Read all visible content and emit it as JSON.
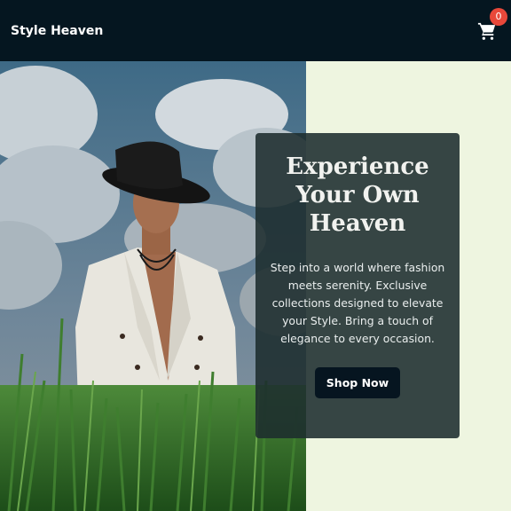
{
  "nav": {
    "brand": "Style Heaven",
    "cart_icon": "shopping-cart-icon",
    "cart_count": "0"
  },
  "hero": {
    "title": "Experience Your Own Heaven",
    "description": "Step into a world where fashion meets serenity. Exclusive collections designed to elevate your Style. Bring a touch of elegance to every occasion.",
    "button_label": "Shop Now"
  },
  "colors": {
    "navbar_bg": "#051620",
    "page_bg": "#eef5e0",
    "badge": "#e8483a",
    "card_bg": "#1c2c2e",
    "button_bg": "#061520"
  }
}
